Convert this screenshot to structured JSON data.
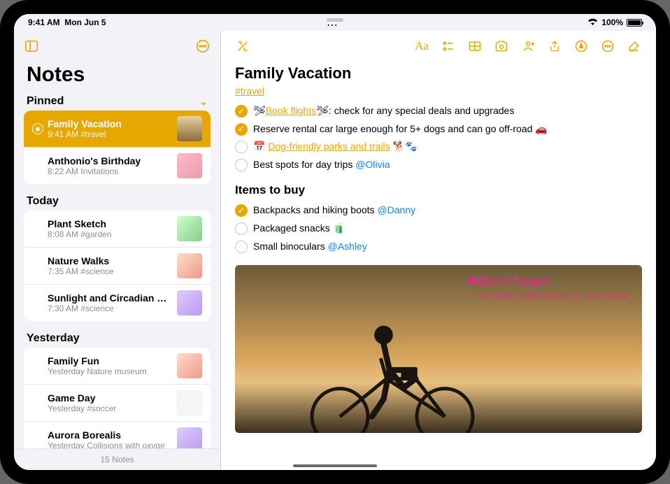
{
  "status": {
    "time": "9:41 AM",
    "date": "Mon Jun 5",
    "battery": "100%"
  },
  "sidebar": {
    "title": "Notes",
    "sections": {
      "pinned": {
        "header": "Pinned",
        "items": [
          {
            "title": "Family Vacation",
            "sub": "9:41 AM  #travel",
            "selected": true
          },
          {
            "title": "Anthonio's Birthday",
            "sub": "8:22 AM  Invitations"
          }
        ]
      },
      "today": {
        "header": "Today",
        "items": [
          {
            "title": "Plant Sketch",
            "sub": "8:08 AM  #garden"
          },
          {
            "title": "Nature Walks",
            "sub": "7:35 AM  #science"
          },
          {
            "title": "Sunlight and Circadian Rhy...",
            "sub": "7:30 AM  #science"
          }
        ]
      },
      "yesterday": {
        "header": "Yesterday",
        "items": [
          {
            "title": "Family Fun",
            "sub": "Yesterday  Nature museum"
          },
          {
            "title": "Game Day",
            "sub": "Yesterday  #soccer"
          },
          {
            "title": "Aurora Borealis",
            "sub": "Yesterday  Collisions with oxyge"
          }
        ]
      }
    },
    "footer": "15 Notes"
  },
  "note": {
    "title": "Family Vacation",
    "tag": "#travel",
    "checklist1": [
      {
        "checked": true,
        "prefix": "🛩",
        "link": "Book flights",
        "suffix": "🛩: check for any special deals and upgrades"
      },
      {
        "checked": true,
        "text": "Reserve rental car large enough for 5+ dogs and can go off-road 🚗"
      },
      {
        "checked": false,
        "prefix": "📅 ",
        "link": "Dog-friendly parks and trails",
        "suffix": " 🐕🐾"
      },
      {
        "checked": false,
        "text": "Best spots for day trips ",
        "mention": "@Olivia"
      }
    ],
    "subheading": "Items to buy",
    "checklist2": [
      {
        "checked": true,
        "text": "Backpacks and hiking boots ",
        "mention": "@Danny"
      },
      {
        "checked": false,
        "text": "Packaged snacks 🧃"
      },
      {
        "checked": false,
        "text": "Small binoculars ",
        "mention": "@Ashley"
      }
    ],
    "handwriting": {
      "main": "✱Don't forget",
      "sub": "— Get photo at this location for epic sunset"
    }
  }
}
